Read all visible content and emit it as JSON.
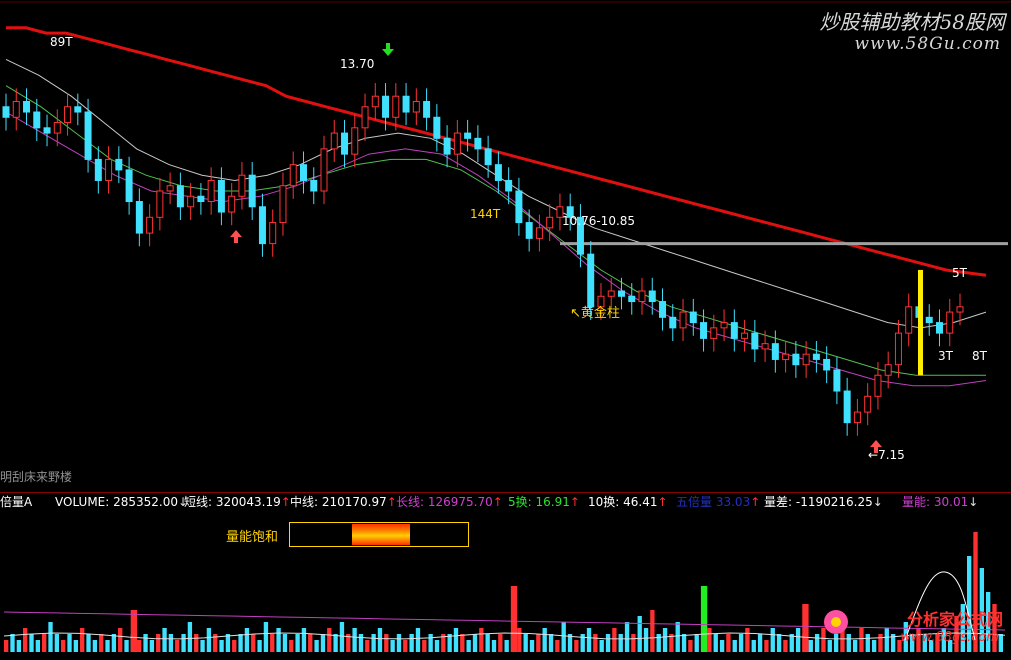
{
  "chart_data": {
    "type": "candlestick",
    "main_price_axis": {
      "ylim": [
        6.5,
        15.2
      ]
    },
    "price_labels": {
      "high": "13.70",
      "low": "7.15",
      "range_line": "10.76-10.85"
    },
    "period_labels": [
      "89T",
      "144T",
      "5T",
      "3T",
      "8T"
    ],
    "golden_pillar_label": "黄金柱",
    "bottom_left_text": "明刮床来野楼",
    "candles_close": [
      13.2,
      13.5,
      13.3,
      13.0,
      12.9,
      13.1,
      13.4,
      13.3,
      12.4,
      12.0,
      12.4,
      12.2,
      11.6,
      11.0,
      11.3,
      11.8,
      11.9,
      11.5,
      11.7,
      11.6,
      12.0,
      11.4,
      11.7,
      12.1,
      11.5,
      10.8,
      11.2,
      11.9,
      12.3,
      12.0,
      11.8,
      12.6,
      12.9,
      12.5,
      13.0,
      13.4,
      13.6,
      13.2,
      13.6,
      13.3,
      13.5,
      13.2,
      12.8,
      12.5,
      12.9,
      12.8,
      12.6,
      12.3,
      12.0,
      11.8,
      11.2,
      10.9,
      11.1,
      11.3,
      11.5,
      11.3,
      10.6,
      9.6,
      9.8,
      9.9,
      9.8,
      9.7,
      9.9,
      9.7,
      9.4,
      9.2,
      9.5,
      9.3,
      9.0,
      9.2,
      9.3,
      9.0,
      9.1,
      8.8,
      8.9,
      8.6,
      8.7,
      8.5,
      8.7,
      8.6,
      8.4,
      8.0,
      7.4,
      7.6,
      7.9,
      8.3,
      8.5,
      9.1,
      9.6,
      9.4,
      9.3,
      9.1,
      9.5,
      9.6
    ],
    "ma_lines": [
      {
        "key": "ma_red",
        "color": "#e01010",
        "values": [
          14.9,
          14.9,
          14.8,
          14.8,
          14.7,
          14.6,
          14.5,
          14.4,
          14.3,
          14.2,
          14.1,
          14.0,
          13.9,
          13.8,
          13.6,
          13.5,
          13.4,
          13.3,
          13.2,
          13.1,
          13.0,
          12.9,
          12.8,
          12.7,
          12.6,
          12.5,
          12.4,
          12.3,
          12.2,
          12.1,
          12.0,
          11.9,
          11.8,
          11.7,
          11.6,
          11.5,
          11.4,
          11.3,
          11.2,
          11.1,
          11.0,
          10.9,
          10.8,
          10.7,
          10.6,
          10.5,
          10.4,
          10.3,
          10.25,
          10.2
        ]
      },
      {
        "key": "ma_white",
        "color": "#c8c8c8",
        "values": [
          14.3,
          14.0,
          13.6,
          13.1,
          12.6,
          12.3,
          12.1,
          12.0,
          12.1,
          12.3,
          12.6,
          12.8,
          12.9,
          12.8,
          12.5,
          12.1,
          11.7,
          11.4,
          11.1,
          10.9,
          10.7,
          10.5,
          10.3,
          10.1,
          9.9,
          9.7,
          9.5,
          9.3,
          9.2,
          9.3,
          9.5
        ]
      },
      {
        "key": "ma_green",
        "color": "#50c050",
        "values": [
          13.8,
          13.4,
          12.9,
          12.4,
          12.1,
          11.9,
          11.8,
          11.8,
          11.9,
          12.1,
          12.3,
          12.4,
          12.4,
          12.2,
          11.8,
          11.3,
          10.8,
          10.3,
          9.9,
          9.6,
          9.4,
          9.2,
          9.0,
          8.8,
          8.6,
          8.4,
          8.3,
          8.3,
          8.3
        ]
      },
      {
        "key": "ma_magenta",
        "color": "#c040c0",
        "values": [
          13.3,
          12.9,
          12.5,
          12.1,
          11.8,
          11.7,
          11.6,
          11.7,
          11.9,
          12.2,
          12.5,
          12.6,
          12.5,
          12.1,
          11.6,
          11.0,
          10.4,
          9.9,
          9.5,
          9.2,
          9.0,
          8.8,
          8.6,
          8.4,
          8.2,
          8.1,
          8.1,
          8.2
        ]
      }
    ],
    "volume_panel": {
      "indicator": "倍量A",
      "volume_label": "VOLUME:",
      "volume_value": "285352.00",
      "short_label": "短线:",
      "short_value": "320043.19",
      "mid_label": "中线:",
      "mid_value": "210170.97",
      "long_label": "长线:",
      "long_value": "126975.70",
      "t5_label": "5换:",
      "t5_value": "16.91",
      "t10_label": "10换:",
      "t10_value": "46.41",
      "hidden_label": "五倍量",
      "hidden_value": "33.03",
      "diff_label": "量差:",
      "diff_value": "-1190216.25",
      "energy_label": "量能:",
      "energy_value": "30.01",
      "saturation_label": "量能饱和",
      "volumes": [
        2,
        3,
        2,
        4,
        3,
        2,
        3,
        5,
        3,
        2,
        3,
        2,
        4,
        3,
        2,
        3,
        2,
        3,
        4,
        2,
        3,
        2,
        3,
        2,
        3,
        4,
        3,
        2,
        3,
        5,
        3,
        2,
        4,
        3,
        2,
        3,
        2,
        3,
        4,
        3,
        2,
        5,
        3,
        4,
        3,
        2,
        3,
        4,
        3,
        2,
        3,
        4,
        3,
        5,
        3,
        4,
        3,
        2,
        3,
        4,
        3,
        2,
        3,
        2,
        3,
        4,
        2,
        3,
        2,
        3,
        3,
        4,
        3,
        2,
        3,
        4,
        3,
        2,
        3,
        2,
        3,
        4,
        3,
        2,
        3,
        4,
        3,
        2,
        5,
        3,
        2,
        3,
        4,
        3,
        2,
        3,
        4,
        3,
        5,
        3,
        6,
        4,
        7,
        3,
        4,
        3,
        5,
        3,
        2,
        3,
        3,
        4,
        3,
        2,
        3,
        2,
        3,
        4,
        2,
        3,
        2,
        4,
        3,
        2,
        3,
        4,
        3,
        2,
        3,
        4,
        2,
        3,
        4,
        3,
        2,
        4,
        3,
        2,
        3,
        4,
        3,
        2,
        5,
        3,
        4,
        3,
        2,
        3,
        4,
        2,
        6,
        8,
        16,
        20,
        14,
        10,
        8,
        3
      ],
      "highlight_bars": [
        {
          "i": 20,
          "v": 7,
          "color": "#ff3030"
        },
        {
          "i": 80,
          "v": 11,
          "color": "#ff3030"
        },
        {
          "i": 110,
          "v": 11,
          "color": "#22ee22"
        },
        {
          "i": 126,
          "v": 8,
          "color": "#ff3030"
        }
      ]
    }
  },
  "watermark": {
    "top_line1": "炒股辅助教材58股网",
    "top_line2": "www.58Gu.com",
    "bottom_line1": "分析家公式网",
    "bottom_line2": "www.88gs.com"
  },
  "colors": {
    "up": "#ff3333",
    "down": "#40e0ff",
    "grid": "#8b0000",
    "range_line": "#a0a0a0",
    "pillar": "#ffee00"
  }
}
